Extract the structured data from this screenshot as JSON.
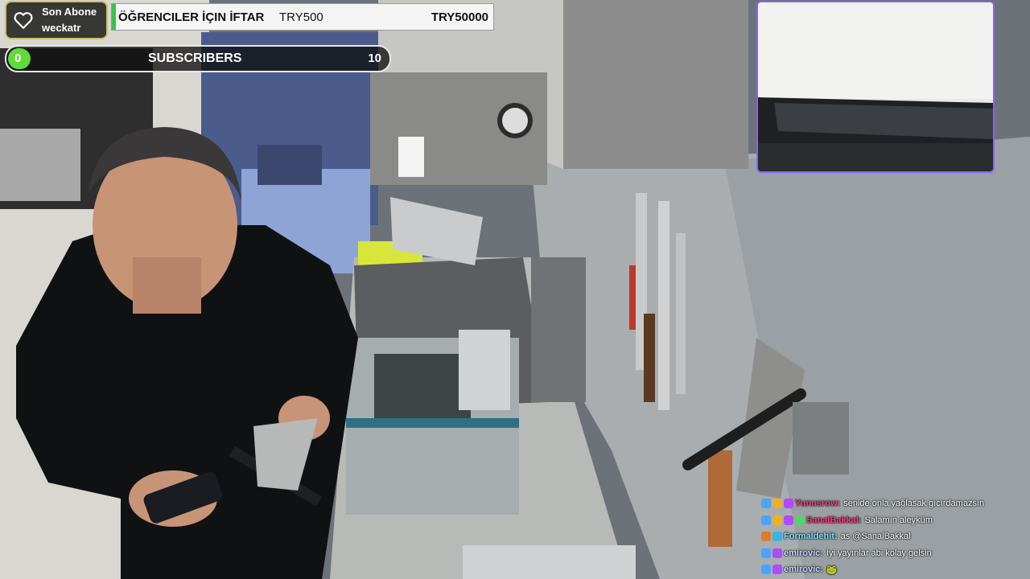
{
  "stream_overlay": {
    "last_subscriber": {
      "title": "Son Abone",
      "name": "weckatr",
      "icon": "heart-icon"
    },
    "donation_goal": {
      "title": "ÖĞRENCILER İÇIN İFTAR",
      "current": "TRY500",
      "target": "TRY50000",
      "progress": 0.01,
      "color": "#3cc24a"
    },
    "subscriber_goal": {
      "current": "0",
      "label": "SUBSCRIBERS",
      "target": "10",
      "progress": 0.0,
      "color": "#5fdc3a"
    },
    "webcam_border_color": "#8a62ff"
  },
  "chat": {
    "messages": [
      {
        "user": "Yunusrow",
        "user_color": "#ff3b7a",
        "text": "senide onla yağlasak gıcırdamazsın",
        "badges": [
          "sword-badge",
          "bits-badge",
          "sub-badge"
        ]
      },
      {
        "user": "SanalBakkal",
        "user_color": "#ff3b7a",
        "text": "Salamın aleyküm",
        "badges": [
          "sword-badge",
          "bits-badge",
          "sub-badge",
          "gift-badge"
        ]
      },
      {
        "user": "Formaldehit",
        "user_color": "#7fe0ff",
        "text": "as @SanalBakkal",
        "badges": [
          "mod-badge",
          "prime-badge"
        ]
      },
      {
        "user": "emirovic",
        "user_color": "#c9d8ff",
        "text": "İyi yayınlar abi kolay gelsin",
        "badges": [
          "sword-badge",
          "sub-badge"
        ]
      },
      {
        "user": "emirovic",
        "user_color": "#c9d8ff",
        "text": "🐸",
        "badges": [
          "sword-badge",
          "sub-badge"
        ]
      }
    ]
  }
}
